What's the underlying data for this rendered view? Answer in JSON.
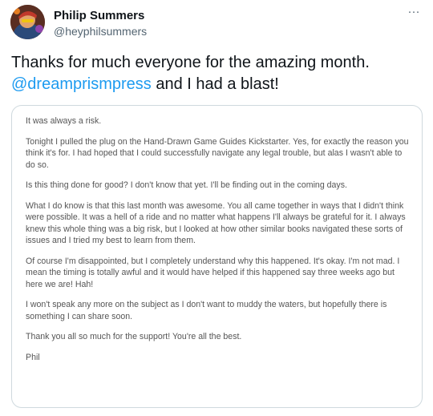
{
  "author": {
    "name": "Philip Summers",
    "handle": "@heyphilsummers",
    "avatar_icon": "avatar-illustration"
  },
  "more_icon": "more-horizontal-icon",
  "more_glyph": "···",
  "tweet": {
    "text_before": "Thanks for much everyone for the amazing month. ",
    "mention": "@dreamprismpress",
    "text_after": " and I had a blast!"
  },
  "attachment": {
    "paragraphs": [
      "It was always a risk.",
      "Tonight I pulled the plug on the Hand-Drawn Game Guides Kickstarter. Yes, for exactly the reason you think it's for. I had hoped that I could successfully navigate any legal trouble, but alas I wasn't able to do so.",
      "Is this thing done for good? I don't know that yet. I'll be finding out in the coming days.",
      "What I do know is that this last month was awesome. You all came together in ways that I didn't think were possible. It was a hell of a ride and no matter what happens I'll always be grateful for it. I always knew this whole thing was a big risk, but I looked at how other similar books navigated these sorts of issues and I tried my best to learn from them.",
      "Of course I'm disappointed, but I completely understand why this happened. It's okay. I'm not mad. I mean the timing is totally awful and it would have helped if this happened say three weeks ago but here we are! Hah!",
      "I won't speak any more on the subject as I don't want to muddy the waters, but hopefully there is something I can share soon.",
      "Thank you all so much for the support! You're all the best.",
      "Phil"
    ]
  },
  "colors": {
    "link": "#1d9bf0",
    "secondary_text": "#536471",
    "border": "#cfd9de"
  }
}
